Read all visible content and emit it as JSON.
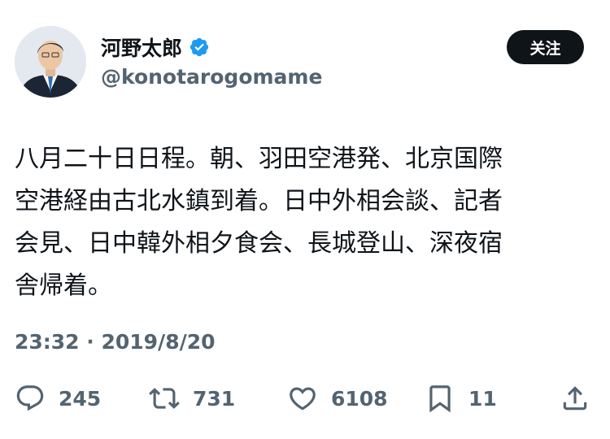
{
  "profile": {
    "display_name": "河野太郎",
    "handle": "@konotarogomame",
    "verified_icon": "verified-badge-icon",
    "follow_label": "关注"
  },
  "tweet": {
    "lines": [
      "八月二十日日程。朝、羽田空港発、北京国際",
      "空港経由古北水鎮到着。日中外相会談、記者",
      "会見、日中韓外相夕食会、長城登山、深夜宿",
      "舎帰着。"
    ],
    "timestamp": "23:32 · 2019/8/20"
  },
  "actions": {
    "reply": {
      "icon": "reply-icon",
      "count": "245"
    },
    "retweet": {
      "icon": "retweet-icon",
      "count": "731"
    },
    "like": {
      "icon": "heart-icon",
      "count": "6108"
    },
    "bookmark": {
      "icon": "bookmark-icon",
      "count": "11"
    },
    "share": {
      "icon": "share-icon"
    }
  },
  "colors": {
    "text": "#0f1419",
    "secondary": "#536471",
    "verified": "#1d9bf0",
    "button_bg": "#0f1419"
  }
}
